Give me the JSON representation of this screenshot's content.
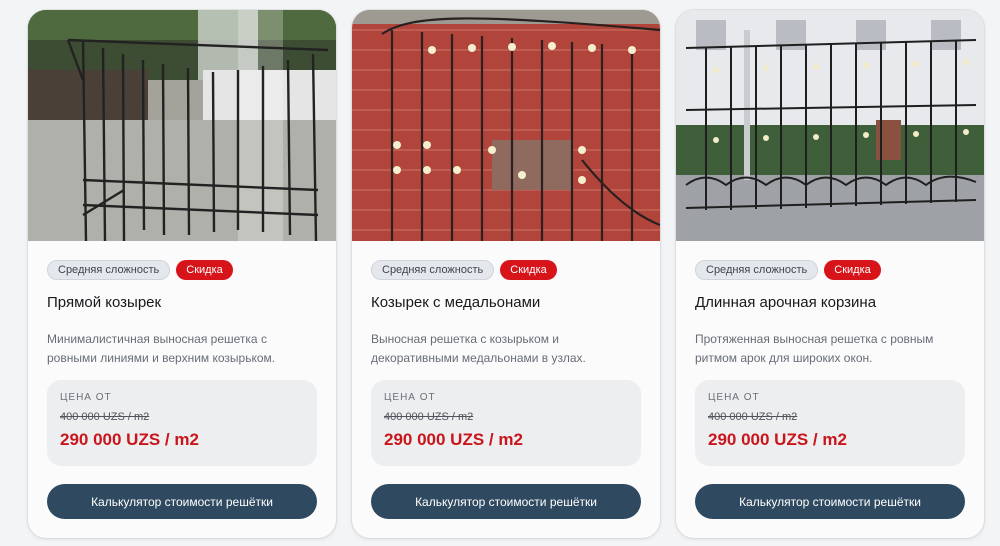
{
  "colors": {
    "accent_red": "#d7141a",
    "price_red": "#c9151b",
    "button": "#2f4a60",
    "card_background": "#fbfbfc"
  },
  "products": [
    {
      "image_alt": "Прямой козырек",
      "tag_difficulty": "Средняя сложность",
      "tag_sale": "Скидка",
      "title": "Прямой козырек",
      "description": "Минималистичная выносная решетка с ровными линиями и верхним козырьком.",
      "price_label": "ЦЕНА ОТ",
      "old_price": "400 000 UZS / m2",
      "new_price": "290 000 UZS / m2",
      "button_label": "Калькулятор стоимости решётки"
    },
    {
      "image_alt": "Козырек с медальонами",
      "tag_difficulty": "Средняя сложность",
      "tag_sale": "Скидка",
      "title": "Козырек с медальонами",
      "description": "Выносная решетка с козырьком и декоративными медальонами в узлах.",
      "price_label": "ЦЕНА ОТ",
      "old_price": "400 000 UZS / m2",
      "new_price": "290 000 UZS / m2",
      "button_label": "Калькулятор стоимости решётки"
    },
    {
      "image_alt": "Длинная арочная корзина",
      "tag_difficulty": "Средняя сложность",
      "tag_sale": "Скидка",
      "title": "Длинная арочная корзина",
      "description": "Протяженная выносная решетка с ровным ритмом арок для широких окон.",
      "price_label": "ЦЕНА ОТ",
      "old_price": "400 000 UZS / m2",
      "new_price": "290 000 UZS / m2",
      "button_label": "Калькулятор стоимости решётки"
    }
  ]
}
